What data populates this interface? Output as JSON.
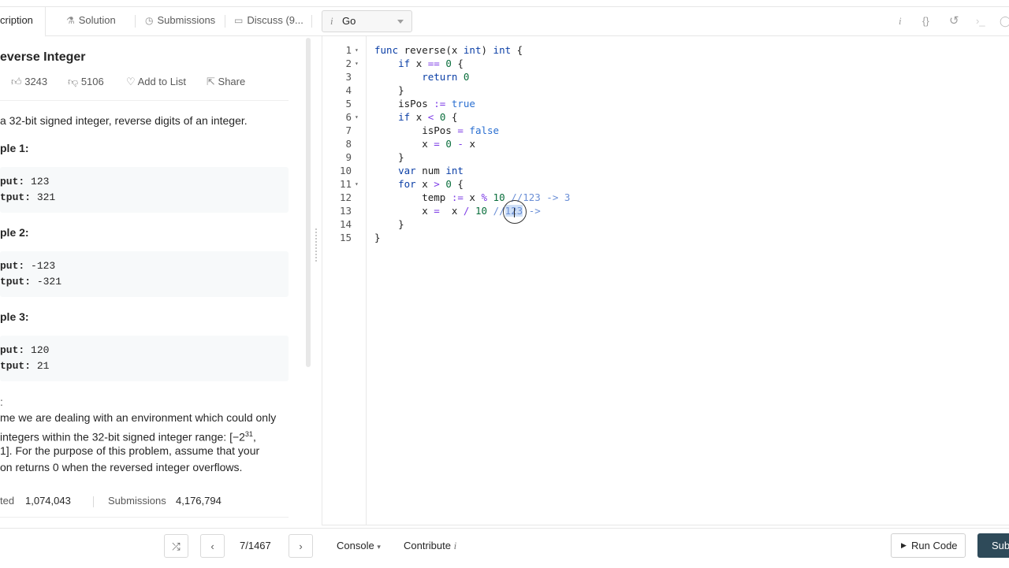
{
  "tabs": [
    {
      "label": "cription",
      "icon": "description-icon"
    },
    {
      "label": "Solution",
      "icon": "flask-icon"
    },
    {
      "label": "Submissions",
      "icon": "clock-icon"
    },
    {
      "label": "Discuss (9...",
      "icon": "comment-icon"
    }
  ],
  "language": {
    "info": "i",
    "value": "Go"
  },
  "toolbar": {
    "info": "i",
    "braces": "{}",
    "reset": "↺",
    "console_glyph": "›_"
  },
  "problem": {
    "title": "everse Integer",
    "likes": "3243",
    "dislikes": "5106",
    "add_to_list": "Add to List",
    "share": "Share",
    "description": " a 32-bit signed integer, reverse digits of an integer.",
    "examples": [
      {
        "heading": "ple 1:",
        "input_label": "put:",
        "input": "123",
        "output_label": "tput:",
        "output": "321"
      },
      {
        "heading": "ple 2:",
        "input_label": "put:",
        "input": "-123",
        "output_label": "tput:",
        "output": "-321"
      },
      {
        "heading": "ple 3:",
        "input_label": "put:",
        "input": "120",
        "output_label": "tput:",
        "output": "21"
      }
    ],
    "note_label": ":",
    "note_lines": [
      "me we are dealing with an environment which could only",
      " integers within the 32-bit signed integer range: [−2",
      "31",
      ",",
      " 1]. For the purpose of this problem, assume that your",
      "on returns 0 when the reversed integer overflows."
    ],
    "accepted_label": "ted",
    "accepted_value": "1,074,043",
    "submissions_label": "Submissions",
    "submissions_value": "4,176,794"
  },
  "code": {
    "line_numbers": [
      "1",
      "2",
      "3",
      "4",
      "5",
      "6",
      "7",
      "8",
      "9",
      "10",
      "11",
      "12",
      "13",
      "14",
      "15"
    ],
    "folds": [
      "▾",
      "▾",
      "",
      "",
      "",
      "▾",
      "",
      "",
      "",
      "",
      "▾",
      "",
      "",
      "",
      ""
    ]
  },
  "bottom": {
    "pager": "7/1467",
    "console": "Console",
    "contribute": "Contribute",
    "contribute_info": "i",
    "run": "Run Code",
    "submit": "Sub"
  }
}
